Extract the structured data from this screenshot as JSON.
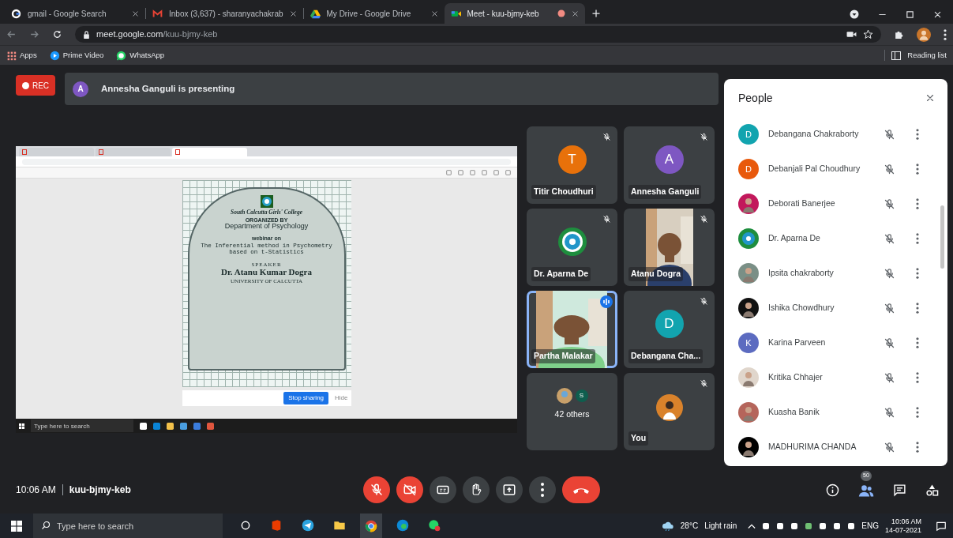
{
  "browser": {
    "tabs": [
      {
        "title": "gmail - Google Search",
        "selected": false,
        "recording": false
      },
      {
        "title": "Inbox (3,637) - sharanyachakrab",
        "selected": false,
        "recording": false
      },
      {
        "title": "My Drive - Google Drive",
        "selected": false,
        "recording": false
      },
      {
        "title": "Meet - kuu-bjmy-keb",
        "selected": true,
        "recording": true
      }
    ],
    "url": {
      "host": "meet.google.com",
      "path": "/kuu-bjmy-keb"
    },
    "bookmarks": [
      {
        "label": "Apps"
      },
      {
        "label": "Prime Video"
      },
      {
        "label": "WhatsApp"
      }
    ],
    "reading_list": "Reading list"
  },
  "meet": {
    "rec": "REC",
    "presenter": {
      "initial": "A",
      "color": "#7e57c2",
      "text": "Annesha Ganguli is presenting"
    },
    "shared_screen": {
      "poster": {
        "college": "South Calcutta Girls' College",
        "organized_by": "ORGANIZED BY",
        "department": "Department of Psychology",
        "webinar": "webinar on",
        "topic": "The Inferential method in Psychometry based on t-Statistics",
        "speaker_label": "SPEAKER",
        "speaker": "Dr. Atanu Kumar Dogra",
        "university": "UNIVERSITY OF CALCUTTA"
      },
      "stop_sharing": "Stop sharing",
      "hide": "Hide",
      "taskbar_search": {
        "placeholder": "Type here to search"
      }
    },
    "tiles": [
      {
        "kind": "avatar",
        "initial": "T",
        "color": "#e8710a",
        "name": "Titir Choudhuri",
        "muted": true,
        "speaking": false
      },
      {
        "kind": "avatar",
        "initial": "A",
        "color": "#7e57c2",
        "name": "Annesha Ganguli",
        "muted": true,
        "speaking": false
      },
      {
        "kind": "logo",
        "name": "Dr. Aparna De",
        "muted": true,
        "speaking": false
      },
      {
        "kind": "video",
        "name": "Atanu Dogra",
        "muted": true,
        "speaking": false
      },
      {
        "kind": "video",
        "name": "Partha Malakar",
        "muted": false,
        "speaking": true
      },
      {
        "kind": "avatar",
        "initial": "D",
        "color": "#12a4af",
        "name": "Debangana Cha...",
        "muted": true,
        "speaking": false
      },
      {
        "kind": "others",
        "badge": "S",
        "name": "42 others",
        "muted": false,
        "speaking": false
      },
      {
        "color": "#d9822b",
        "name": "You",
        "muted": true,
        "speaking": false
      }
    ],
    "people": {
      "title": "People",
      "items": [
        {
          "kind": "initial",
          "initial": "D",
          "color": "#12a4af",
          "name": "Debangana Chakraborty",
          "muted": true
        },
        {
          "kind": "initial",
          "initial": "D",
          "color": "#e8590c",
          "name": "Debanjali Pal Choudhury",
          "muted": true
        },
        {
          "color": "#c2185b",
          "name": "Deborati Banerjee",
          "muted": true
        },
        {
          "kind": "logo",
          "color": "#1e8e3e",
          "name": "Dr. Aparna De",
          "muted": true
        },
        {
          "color": "#7a8f86",
          "name": "Ipsita chakraborty",
          "muted": true
        },
        {
          "color": "#111111",
          "name": "Ishika Chowdhury",
          "muted": true
        },
        {
          "kind": "initial",
          "initial": "K",
          "color": "#5c6bc0",
          "name": "Karina Parveen",
          "muted": true
        },
        {
          "color": "#e0d6cc",
          "name": "Kritika Chhajer",
          "muted": true
        },
        {
          "color": "#b5655b",
          "name": "Kuasha Banik",
          "muted": true
        },
        {
          "color": "#000000",
          "name": "MADHURIMA CHANDA",
          "muted": true
        }
      ]
    },
    "time": "10:06 AM",
    "meeting_code": "kuu-bjmy-keb",
    "controls": [
      {
        "kind": "mic",
        "on": false
      },
      {
        "kind": "camera",
        "on": false
      },
      {
        "kind": "captions"
      },
      {
        "kind": "hand"
      },
      {
        "kind": "present"
      },
      {
        "kind": "more"
      },
      {
        "kind": "leave"
      }
    ],
    "participant_count": "50"
  },
  "taskbar": {
    "search_placeholder": "Type here to search",
    "temperature": "28°C",
    "weather": "Light rain",
    "language": "ENG",
    "time": "10:06 AM",
    "date": "14-07-2021"
  }
}
